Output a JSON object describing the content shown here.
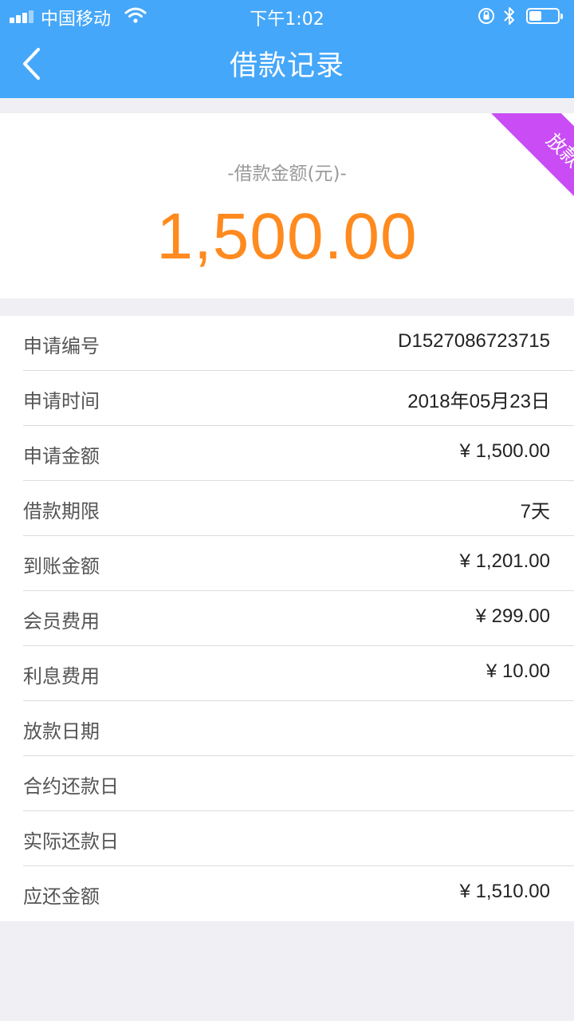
{
  "status_bar": {
    "carrier": "中国移动",
    "time": "下午1:02",
    "battery_level": 0.45
  },
  "nav": {
    "title": "借款记录",
    "back_icon": "chevron-left-icon"
  },
  "summary": {
    "label": "-借款金额(元)-",
    "amount": "1,500.00",
    "status": "放款中"
  },
  "colors": {
    "header": "#45a7f9",
    "amount": "#ff8a1f",
    "status_ribbon": "#c94cf5"
  },
  "details": [
    {
      "label": "申请编号",
      "value": "D1527086723715"
    },
    {
      "label": "申请时间",
      "value": "2018年05月23日"
    },
    {
      "label": "申请金额",
      "value": "¥ 1,500.00"
    },
    {
      "label": "借款期限",
      "value": "7天"
    },
    {
      "label": "到账金额",
      "value": "¥ 1,201.00"
    },
    {
      "label": "会员费用",
      "value": "¥ 299.00"
    },
    {
      "label": "利息费用",
      "value": "¥ 10.00"
    },
    {
      "label": "放款日期",
      "value": ""
    },
    {
      "label": "合约还款日",
      "value": ""
    },
    {
      "label": "实际还款日",
      "value": ""
    },
    {
      "label": "应还金额",
      "value": "¥ 1,510.00"
    }
  ]
}
